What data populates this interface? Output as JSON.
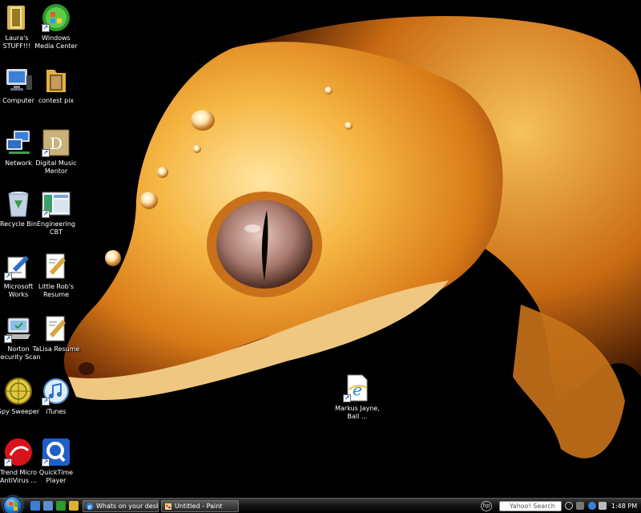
{
  "desktop": {
    "icons": [
      {
        "label": "Laura's STUFF!!!",
        "icon": "folder-icon"
      },
      {
        "label": "Windows Media Center",
        "icon": "windows-media-center-icon"
      },
      {
        "label": "Computer",
        "icon": "computer-icon"
      },
      {
        "label": "contest pix",
        "icon": "folder-icon"
      },
      {
        "label": "Network",
        "icon": "network-icon"
      },
      {
        "label": "Digital Music Mentor",
        "icon": "digital-music-mentor-icon"
      },
      {
        "label": "Recycle Bin",
        "icon": "recycle-bin-icon"
      },
      {
        "label": "Engineering CBT",
        "icon": "engineering-cbt-icon"
      },
      {
        "label": "Microsoft Works",
        "icon": "microsoft-works-icon"
      },
      {
        "label": "Little Rob's Resume",
        "icon": "document-icon"
      },
      {
        "label": "Norton Security Scan",
        "icon": "norton-icon"
      },
      {
        "label": "TaLisa Resume",
        "icon": "document-icon"
      },
      {
        "label": "Spy Sweeper",
        "icon": "spy-sweeper-icon"
      },
      {
        "label": "iTunes",
        "icon": "itunes-icon"
      },
      {
        "label": "Trend Micro AntiVirus ...",
        "icon": "trend-micro-icon"
      },
      {
        "label": "QuickTime Player",
        "icon": "quicktime-icon"
      },
      {
        "label": "Markus Jayne, Ball ...",
        "icon": "internet-explorer-icon"
      }
    ]
  },
  "taskbar": {
    "buttons": [
      {
        "label": "Whats on your desk...",
        "icon": "internet-explorer-icon"
      },
      {
        "label": "Untitled - Paint",
        "icon": "paint-icon"
      }
    ],
    "search_placeholder": "Yahoo! Search",
    "hp_label": "hp",
    "clock": "1:48 PM"
  },
  "colors": {
    "gecko_orange": "#e89a2a",
    "gecko_highlight": "#ffd77a",
    "taskbar": "#141414"
  }
}
